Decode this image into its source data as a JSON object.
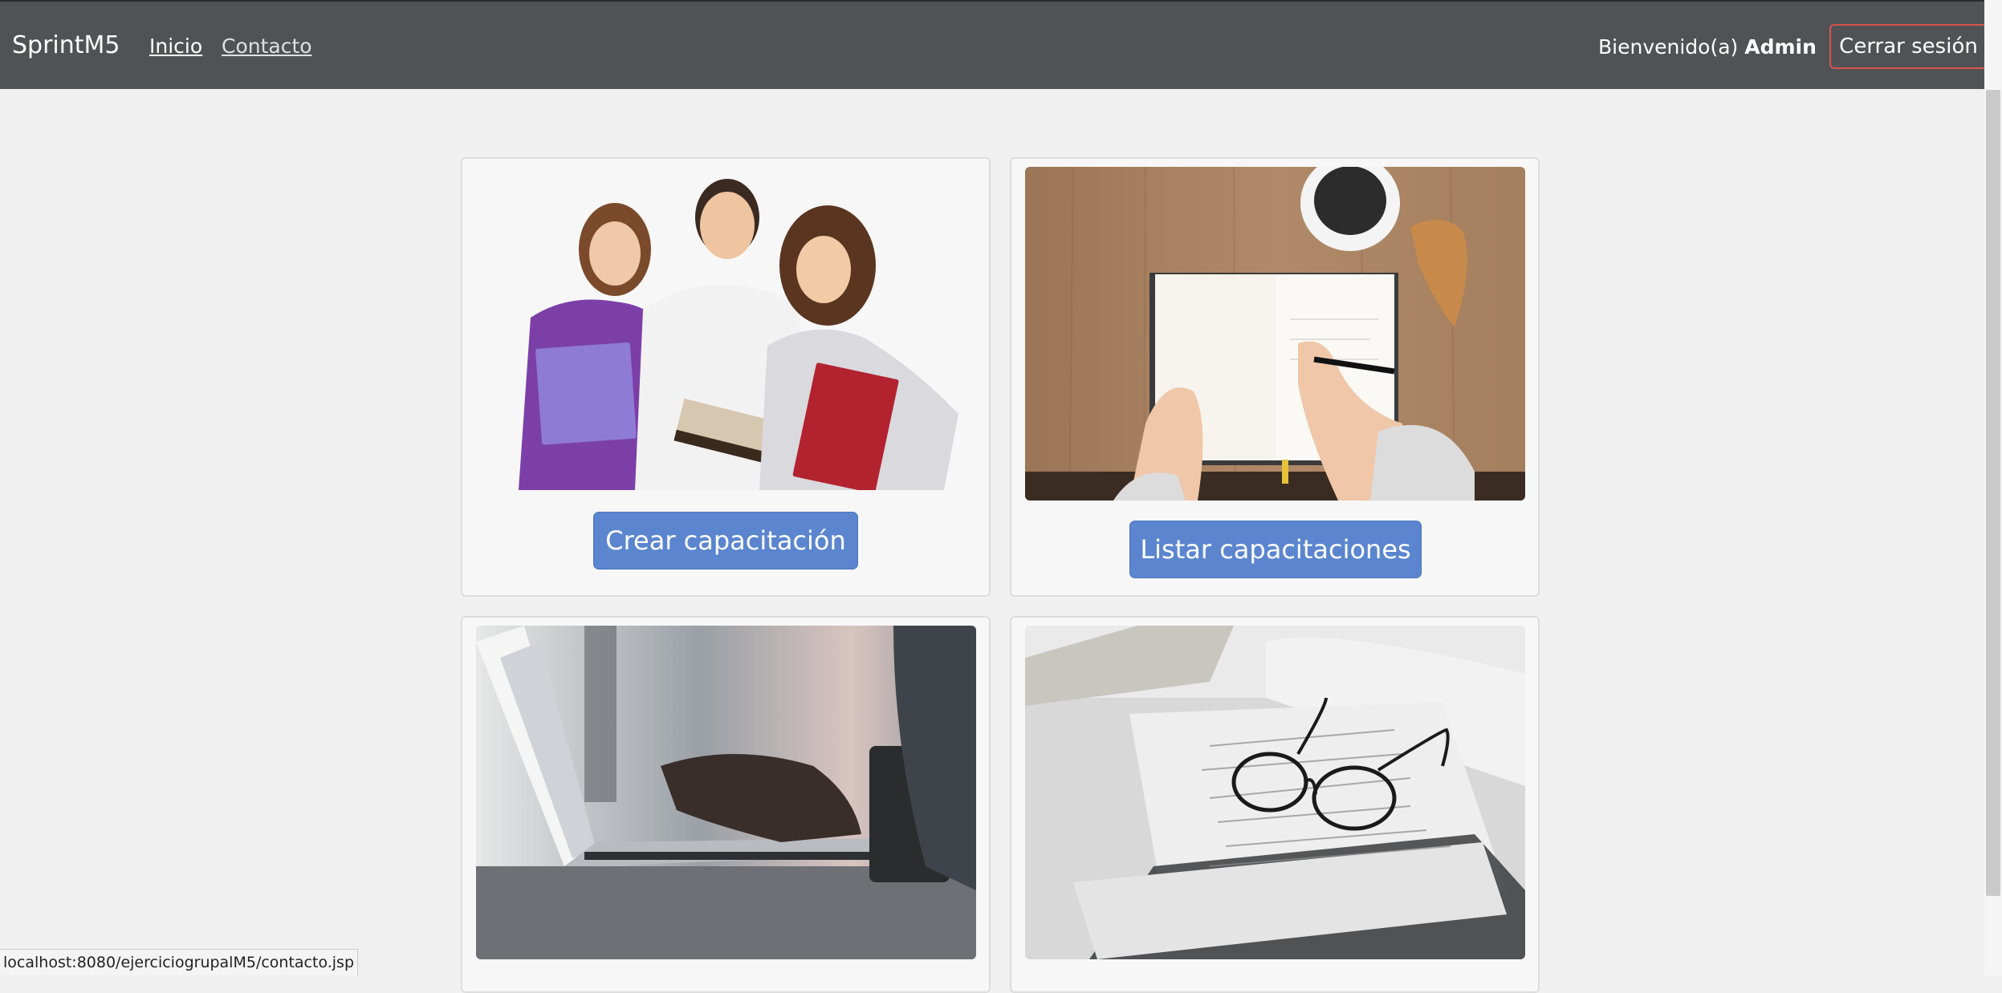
{
  "navbar": {
    "brand": "SprintM5",
    "links": [
      {
        "label": "Inicio"
      },
      {
        "label": "Contacto"
      }
    ],
    "welcome_prefix": "Bienvenido(a) ",
    "user_name": "Admin",
    "logout_label": "Cerrar sesión"
  },
  "cards": [
    {
      "image": "students-holding-books-photo",
      "button_label": "Crear capacitación"
    },
    {
      "image": "notebook-writing-desk-photo",
      "button_label": "Listar capacitaciones"
    },
    {
      "image": "laptop-typing-photo"
    },
    {
      "image": "glasses-on-notes-photo"
    }
  ],
  "status_bar": {
    "url": "localhost:8080/ejerciciogrupalM5/contacto.jsp"
  }
}
